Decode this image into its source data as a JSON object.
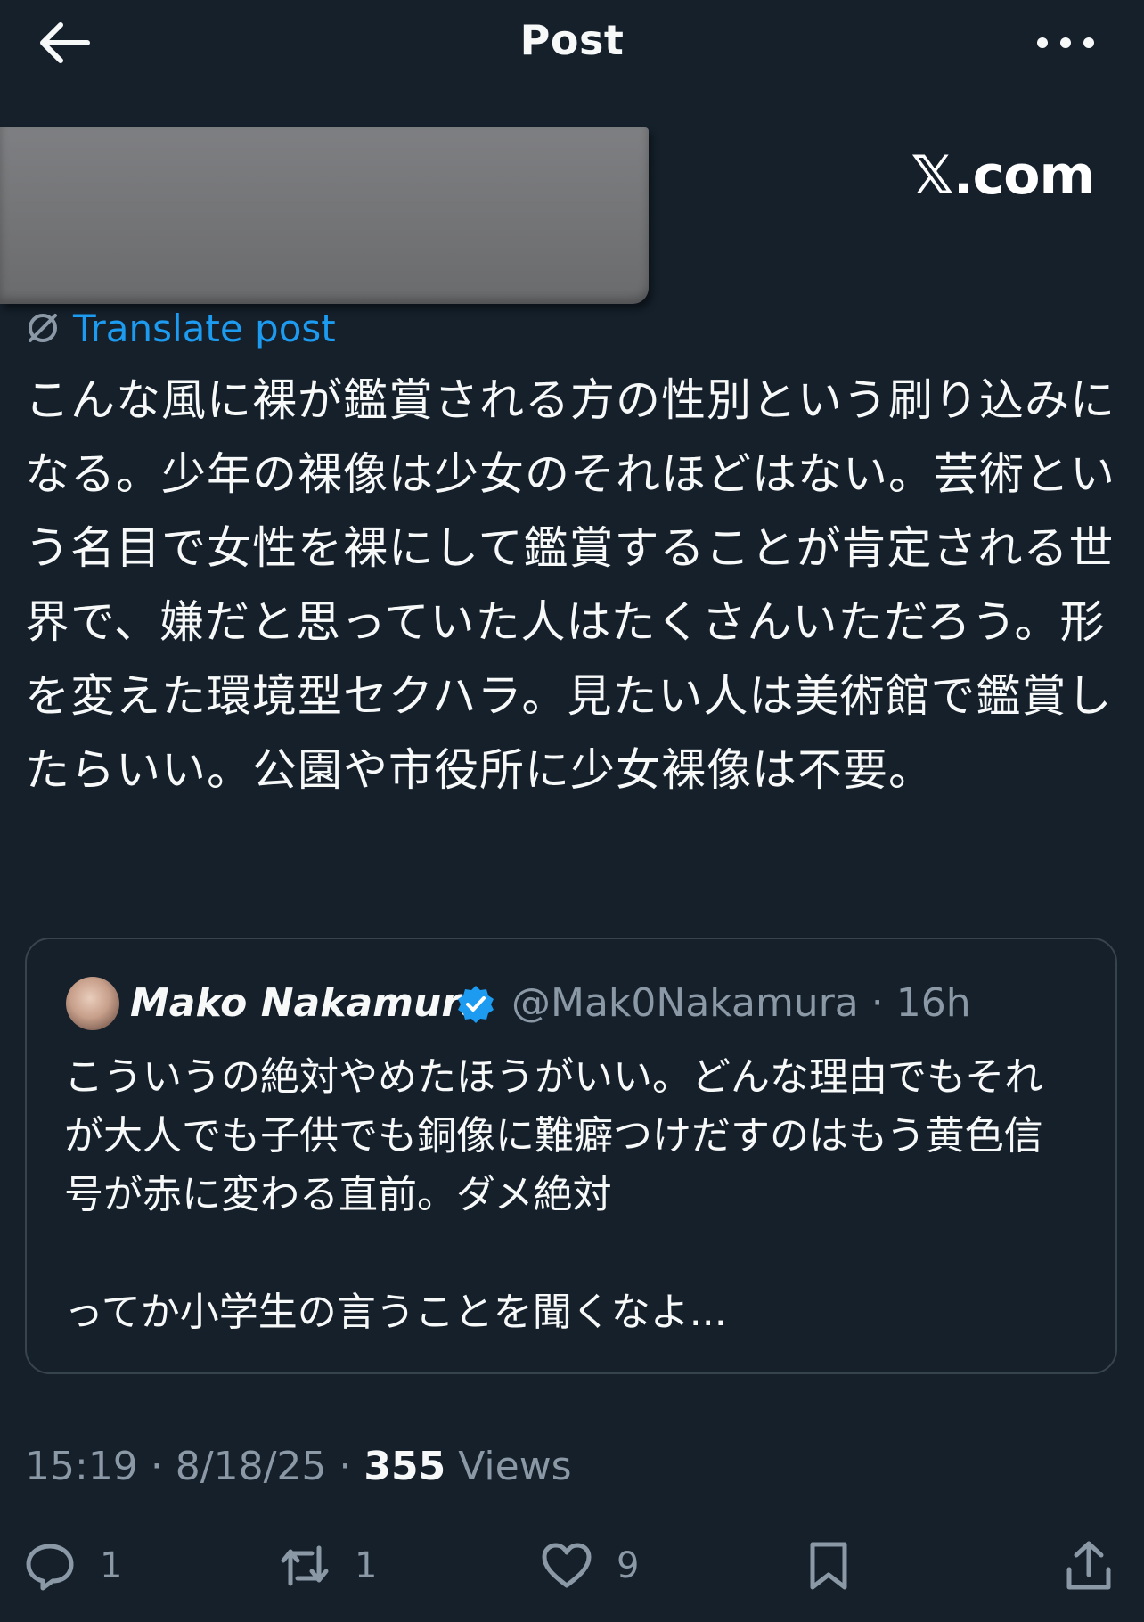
{
  "header": {
    "title": "Post"
  },
  "watermark": "𝕏.com",
  "translate_label": "Translate post",
  "post_text": "こんな風に裸が鑑賞される方の性別という刷り込みになる。少年の裸像は少女のそれほどはない。芸術という名目で女性を裸にして鑑賞することが肯定される世界で、嫌だと思っていた人はたくさんいただろう。形を変えた環境型セクハラ。見たい人は美術館で鑑賞したらいい。公園や市役所に少女裸像は不要。",
  "quote": {
    "name": "Mako Nakamura",
    "handle": "@Mak0Nakamura",
    "time": "16h",
    "text": "こういうの絶対やめたほうがいい。どんな理由でもそれが大人でも子供でも銅像に難癖つけだすのはもう黄色信号が赤に変わる直前。ダメ絶対\n\nってか小学生の言うことを聞くなよ..."
  },
  "meta": {
    "time": "15:19",
    "date": "8/18/25",
    "views_count": "355",
    "views_label": "Views"
  },
  "actions": {
    "replies": "1",
    "reposts": "1",
    "likes": "9"
  },
  "colors": {
    "background": "#15202b",
    "accent": "#1d9bf0",
    "muted": "#8b98a5",
    "border": "#38444d"
  }
}
